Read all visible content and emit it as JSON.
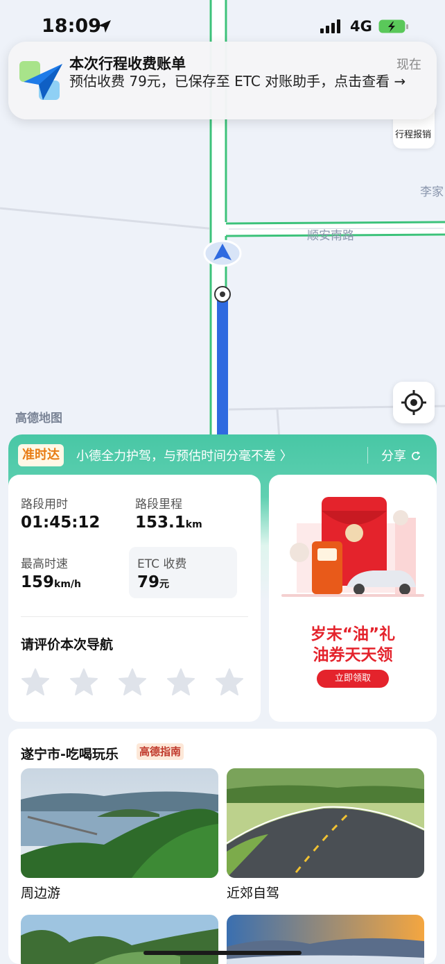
{
  "status_bar": {
    "time": "18:09",
    "network": "4G"
  },
  "notification": {
    "title": "本次行程收费账单",
    "time": "现在",
    "body": "预估收费 79元，已保存至 ETC 对账助手，点击查看 →"
  },
  "map": {
    "road_label": "顺安南路",
    "place_label": "李家",
    "logo": "高德地图",
    "trip_report_label": "行程报销"
  },
  "banner": {
    "badge": "准时达",
    "text": "小德全力护驾，与预估时间分毫不差 〉",
    "share_label": "分享"
  },
  "stats": {
    "duration_label": "路段用时",
    "duration_value": "01:45:12",
    "distance_label": "路段里程",
    "distance_value": "153.1",
    "distance_unit": "km",
    "max_speed_label": "最高时速",
    "max_speed_value": "159",
    "max_speed_unit": "km/h",
    "etc_label": "ETC 收费",
    "etc_value": "79",
    "etc_unit": "元"
  },
  "rating": {
    "title": "请评价本次导航",
    "stars_selected": 0,
    "stars_total": 5
  },
  "promo": {
    "line1": "岁末“油”礼",
    "line2": "油券天天领",
    "button": "立即领取"
  },
  "guide": {
    "title": "遂宁市-吃喝玩乐",
    "tag": "高德指南",
    "items": [
      {
        "label": "周边游"
      },
      {
        "label": "近郊自驾"
      }
    ]
  },
  "colors": {
    "accent": "#48c7a5",
    "route": "#2f6ae0",
    "promo_red": "#e4232c"
  }
}
